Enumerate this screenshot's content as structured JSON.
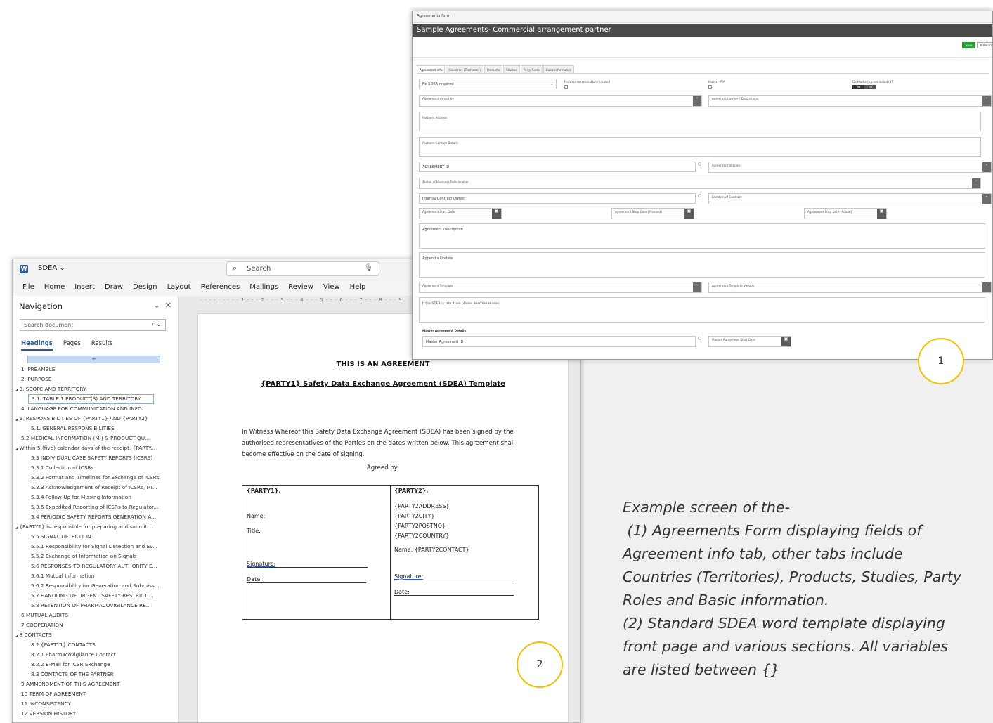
{
  "word": {
    "doc_name": "SDEA",
    "search_placeholder": "Search",
    "menu": [
      "File",
      "Home",
      "Insert",
      "Draw",
      "Design",
      "Layout",
      "References",
      "Mailings",
      "Review",
      "View",
      "Help"
    ],
    "nav": {
      "title": "Navigation",
      "search_placeholder": "Search document",
      "tabs": [
        "Headings",
        "Pages",
        "Results"
      ],
      "items": [
        "1. PREAMBLE",
        "2. PURPOSE",
        "3. SCOPE AND TERRITORY",
        "3.1. TABLE 1 PRODUCT(S) AND TERRITORY",
        "4. LANGUAGE FOR COMMUNICATION AND INFO...",
        "5. RESPONSIBILITIES OF {PARTY1} AND {PARTY2}",
        "5.1. GENERAL RESPONSIBILITIES",
        "5.2 MEDICAL INFORMATION (MI) & PRODUCT QU...",
        "Within 5 (five) calendar days of the receipt, {PARTY...",
        "5.3 INDIVIDUAL CASE SAFETY REPORTS (ICSRS)",
        "5.3.1 Collection of ICSRs",
        "5.3.2 Format and Timelines for Exchange of ICSRs",
        "5.3.3 Acknowledgement of Receipt of ICSRs, MI...",
        "5.3.4 Follow-Up for Missing Information",
        "5.3.5 Expedited Reporting of ICSRs to Regulator...",
        "5.4 PERIODIC SAFETY REPORTS GENERATION A...",
        "{PARTY1} is responsible for preparing and submitti...",
        "5.5 SIGNAL DETECTION",
        "5.5.1 Responsibility for Signal Detection and Ev...",
        "5.5.2 Exchange of Information on Signals",
        "5.6 RESPONSES TO REGULATORY AUTHORITY E...",
        "5.6.1 Mutual Information",
        "5.6.2 Responsibility for Generation and Submiss...",
        "5.7 HANDLING OF URGENT SAFETY RESTRICTI...",
        "5.8 RETENTION OF PHARMACOVIGILANCE RE...",
        "6 MUTUAL AUDITS",
        "7 COOPERATION",
        "8 CONTACTS",
        "8.2 {PARTY1} CONTACTS",
        "8.2.1 Pharmacovigilance Contact",
        "8.2.2 E-Mail for ICSR Exchange",
        "8.3 CONTACTS OF THE PARTNER",
        "9 AMMENDMENT OF THIS AGREEMENT",
        "10 TERM OF AGREEMENT",
        "11 INCONSISTENCY",
        "12 VERSION HISTORY"
      ]
    },
    "ruler": "· · · · · · · · · 1 · · · 2 · · · 3 · · · 4 · · · 5 · · · 6 · · · 7 · · · 8 · · · 9",
    "page": {
      "heading1": "THIS IS AN AGREEMENT",
      "heading2": "{PARTY1} Safety Data Exchange Agreement (SDEA) Template",
      "paragraph": "In Witness Whereof this Safety Data Exchange Agreement (SDEA) has been signed by the authorised representatives of the Parties on the dates written below. This agreement shall become effective on the date of signing.",
      "agreed_by": "Agreed by:",
      "left": {
        "party": "{PARTY1},",
        "name": "Name:",
        "title": "Title:",
        "signature": "Signature:",
        "date": "Date:"
      },
      "right": {
        "party": "{PARTY2},",
        "addr1": "{PARTY2ADDRESS}",
        "addr2": "{PARTY2CITY}",
        "addr3": "{PARTY2POSTNO}",
        "addr4": "{PARTY2COUNTRY}",
        "name": "Name:  {PARTY2CONTACT}",
        "signature": "Signature:",
        "date": "Date:"
      }
    }
  },
  "form": {
    "window_label": "Agreements form",
    "title": "Sample Agreements- Commercial arrangement partner",
    "save": "Save",
    "return": "Return",
    "tabs": [
      "Agreement info",
      "Countries (Territories)",
      "Products",
      "Studies",
      "Party Roles",
      "Basic information"
    ],
    "fields": {
      "sdea_select": "No SDEA required",
      "periodic_recon": "Periodic reconciliation required",
      "master_pva": "Master PVA",
      "go_marketing": "Go Marketing not included?",
      "yes": "Yes",
      "no": "No",
      "owned_by": "Agreement owned by",
      "dept": "Agreement owner / Department",
      "partner_address": "Partners Address",
      "partner_contact": "Partners Contact Details",
      "agreement_id": "AGREEMENT ID",
      "agreement_version": "Agreement Version",
      "status_business": "Status of Business Relationship",
      "internal_owner": "Internal Contract Owner",
      "location": "Location of Contract",
      "start_date": "Agreement Start Date",
      "stop_date": "Agreement Stop Date (Planned)",
      "stop_date_actual": "Agreement Stop Date (Actual)",
      "description": "Agreement Description",
      "appendix": "Appendix Update",
      "template": "Agreement Template",
      "template_version": "Agreement Template Version",
      "late_reason": "If the SDEA is late, then please describe reason",
      "master_details": "Master Agreement Details",
      "master_id": "Master Agreement ID",
      "master_start": "Master Agreement Start Date"
    }
  },
  "callouts": {
    "one": "1",
    "two": "2"
  },
  "caption": [
    "Example screen of the-",
    " (1) Agreements Form displaying fields of",
    "Agreement info tab, other tabs include",
    "Countries (Territories), Products, Studies, Party",
    "Roles and Basic information.",
    "(2) Standard SDEA word template displaying",
    "front page and various sections. All variables",
    "are listed between {}"
  ]
}
